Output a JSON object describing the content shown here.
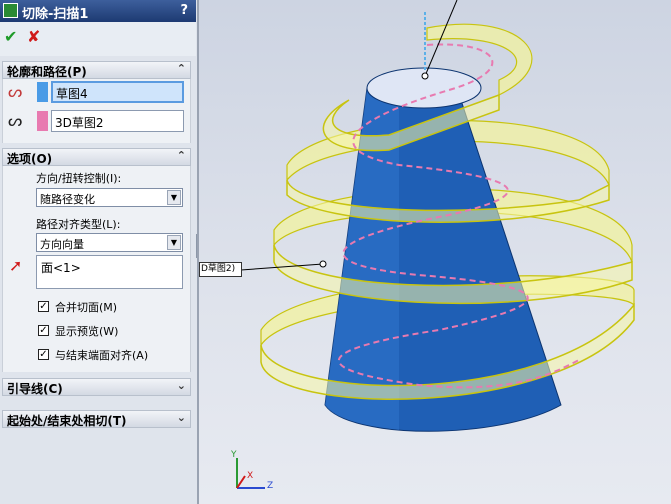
{
  "panel": {
    "title": "切除-扫描1",
    "help": "?",
    "ok_symbol": "✔",
    "cancel_symbol": "✘"
  },
  "profile_section": {
    "title": "轮廓和路径(P)",
    "profile_value": "草图4",
    "path_value": "3D草图2",
    "profile_color": "#4a9be6",
    "path_color": "#e87ab0"
  },
  "options_section": {
    "title": "选项(O)",
    "orientation_label": "方向/扭转控制(I):",
    "orientation_value": "随路径变化",
    "alignment_label": "路径对齐类型(L):",
    "alignment_value": "方向向量",
    "direction_value": "面<1>",
    "checkboxes": [
      {
        "label": "合并切面(M)",
        "checked": true
      },
      {
        "label": "显示预览(W)",
        "checked": true
      },
      {
        "label": "与结束端面对齐(A)",
        "checked": true
      }
    ]
  },
  "guide_section": {
    "title": "引导线(C)"
  },
  "tangency_section": {
    "title": "起始处/结束处相切(T)"
  },
  "viewport": {
    "callout_label": "D草图2)",
    "axis_x": "X",
    "axis_y": "Y",
    "axis_z": "Z"
  }
}
